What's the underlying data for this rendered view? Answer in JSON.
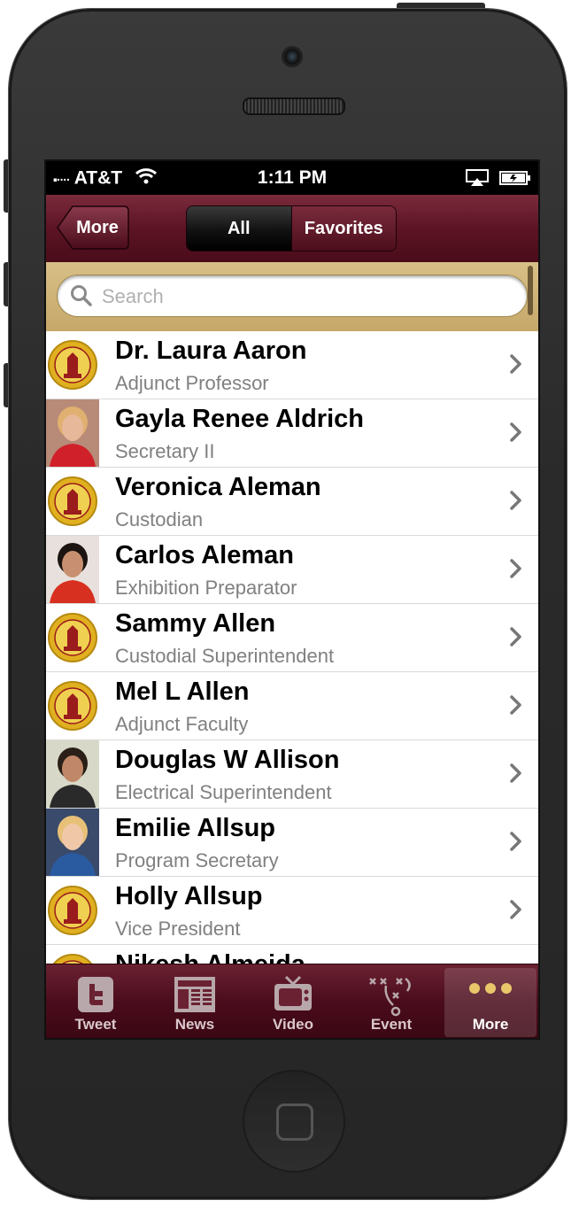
{
  "status_bar": {
    "carrier": "AT&T",
    "time": "1:11 PM"
  },
  "nav": {
    "back_label": "More",
    "segments": [
      "All",
      "Favorites"
    ],
    "selected_segment": "All"
  },
  "search": {
    "placeholder": "Search",
    "value": ""
  },
  "contacts": [
    {
      "name": "Dr. Laura Aaron",
      "title": "Adjunct Professor",
      "avatar": "seal"
    },
    {
      "name": "Gayla Renee Aldrich",
      "title": "Secretary II",
      "avatar": "photo"
    },
    {
      "name": "Veronica Aleman",
      "title": "Custodian",
      "avatar": "seal"
    },
    {
      "name": "Carlos Aleman",
      "title": "Exhibition Preparator",
      "avatar": "photo"
    },
    {
      "name": "Sammy Allen",
      "title": "Custodial Superintendent",
      "avatar": "seal"
    },
    {
      "name": "Mel L Allen",
      "title": "Adjunct Faculty",
      "avatar": "seal"
    },
    {
      "name": "Douglas W Allison",
      "title": "Electrical Superintendent",
      "avatar": "photo"
    },
    {
      "name": "Emilie Allsup",
      "title": "Program Secretary",
      "avatar": "photo"
    },
    {
      "name": "Holly Allsup",
      "title": "Vice President",
      "avatar": "seal"
    },
    {
      "name": "Nikesh Almeida",
      "title": "",
      "avatar": "seal"
    }
  ],
  "tabbar": {
    "items": [
      {
        "label": "Tweet",
        "icon": "twitter-icon"
      },
      {
        "label": "News",
        "icon": "newspaper-icon"
      },
      {
        "label": "Video",
        "icon": "tv-icon"
      },
      {
        "label": "Event",
        "icon": "playbook-icon"
      },
      {
        "label": "More",
        "icon": "more-dots-icon"
      }
    ],
    "active": "More"
  },
  "colors": {
    "nav_maroon": "#5c1424",
    "search_gold": "#d1b87c",
    "seal_gold": "#e0b020",
    "seal_red": "#9a1c1c"
  }
}
